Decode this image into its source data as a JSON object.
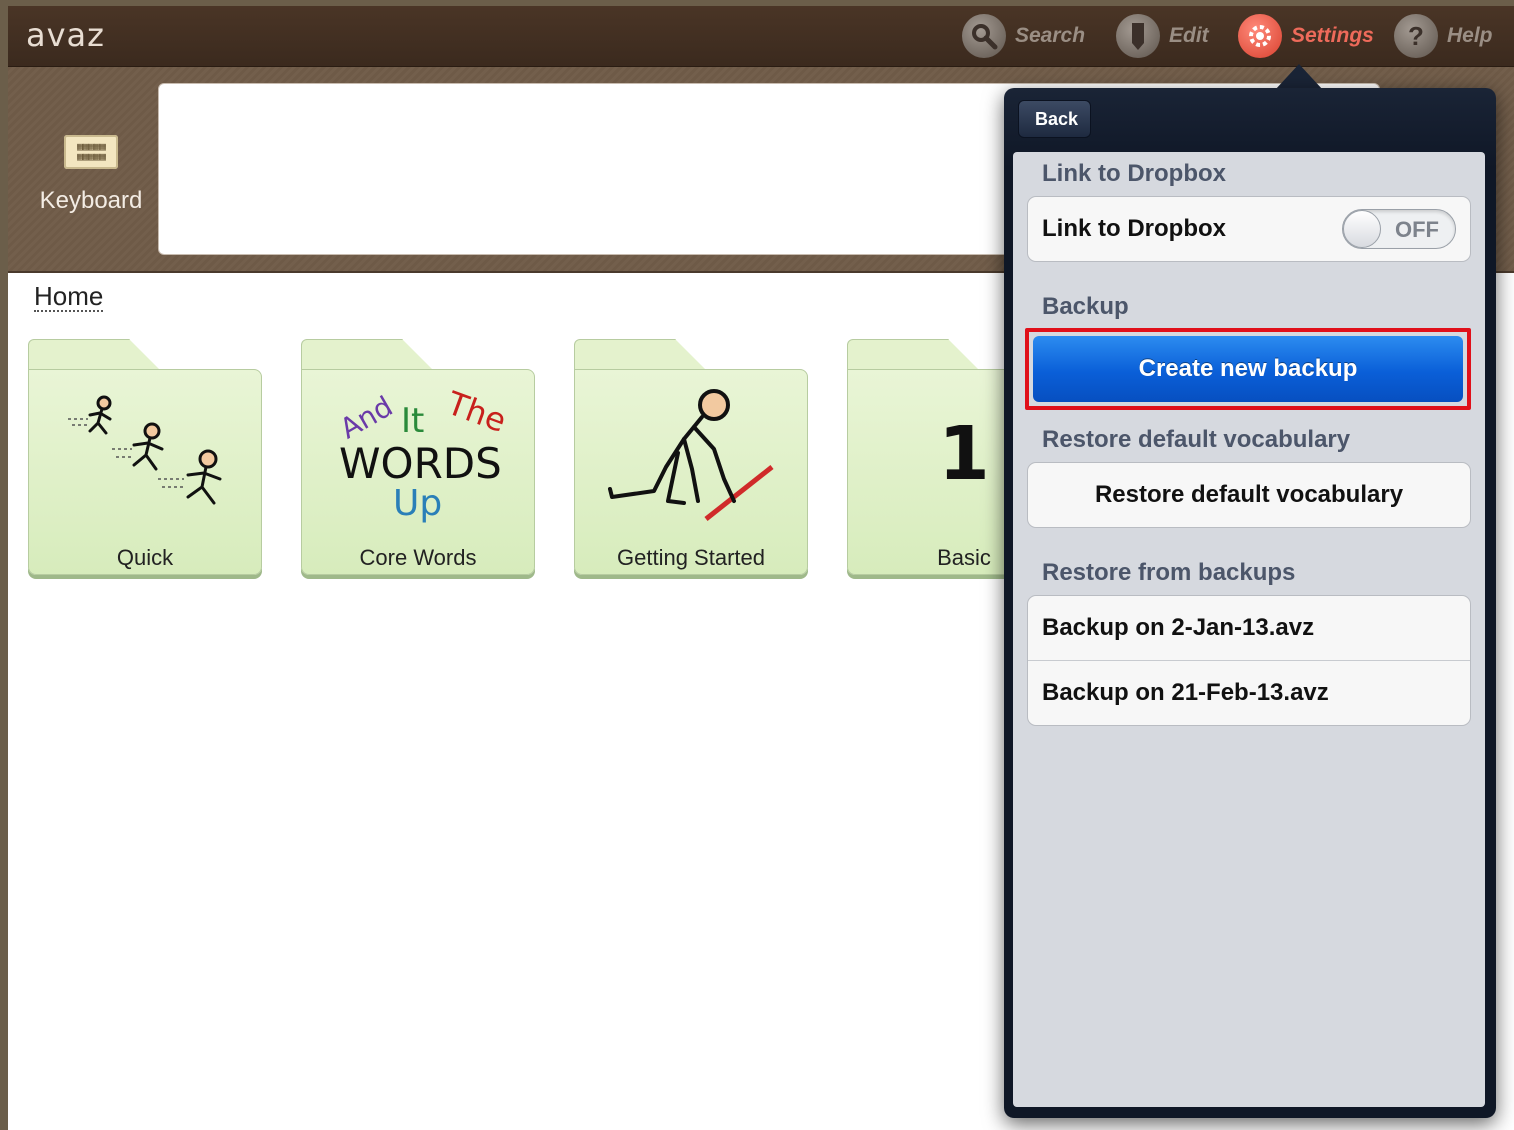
{
  "app": {
    "logo": "avaz"
  },
  "toolbar": {
    "search_label": "Search",
    "edit_label": "Edit",
    "settings_label": "Settings",
    "help_label": "Help"
  },
  "keyboard": {
    "label": "Keyboard"
  },
  "home": {
    "breadcrumb": "Home",
    "tiles": [
      {
        "label": "Quick"
      },
      {
        "label": "Core Words",
        "words": [
          "And",
          "It",
          "The",
          "WORDS",
          "Up"
        ]
      },
      {
        "label": "Getting Started"
      },
      {
        "label": "Basic",
        "number": "1"
      }
    ]
  },
  "settings_panel": {
    "back_label": "Back",
    "sections": {
      "dropbox_header": "Link to Dropbox",
      "dropbox_cell": "Link to Dropbox",
      "dropbox_toggle": "OFF",
      "backup_header": "Backup",
      "backup_button": "Create new backup",
      "restore_default_header": "Restore default vocabulary",
      "restore_default_button": "Restore default vocabulary",
      "restore_backups_header": "Restore from backups",
      "backups": [
        "Backup on 2-Jan-13.avz",
        "Backup on 21-Feb-13.avz"
      ]
    }
  },
  "colors": {
    "accent": "#ee6a5a",
    "primary_button": "#0a5fd8",
    "highlight_border": "#e0101a",
    "tile_green": "#e4f2cd"
  }
}
